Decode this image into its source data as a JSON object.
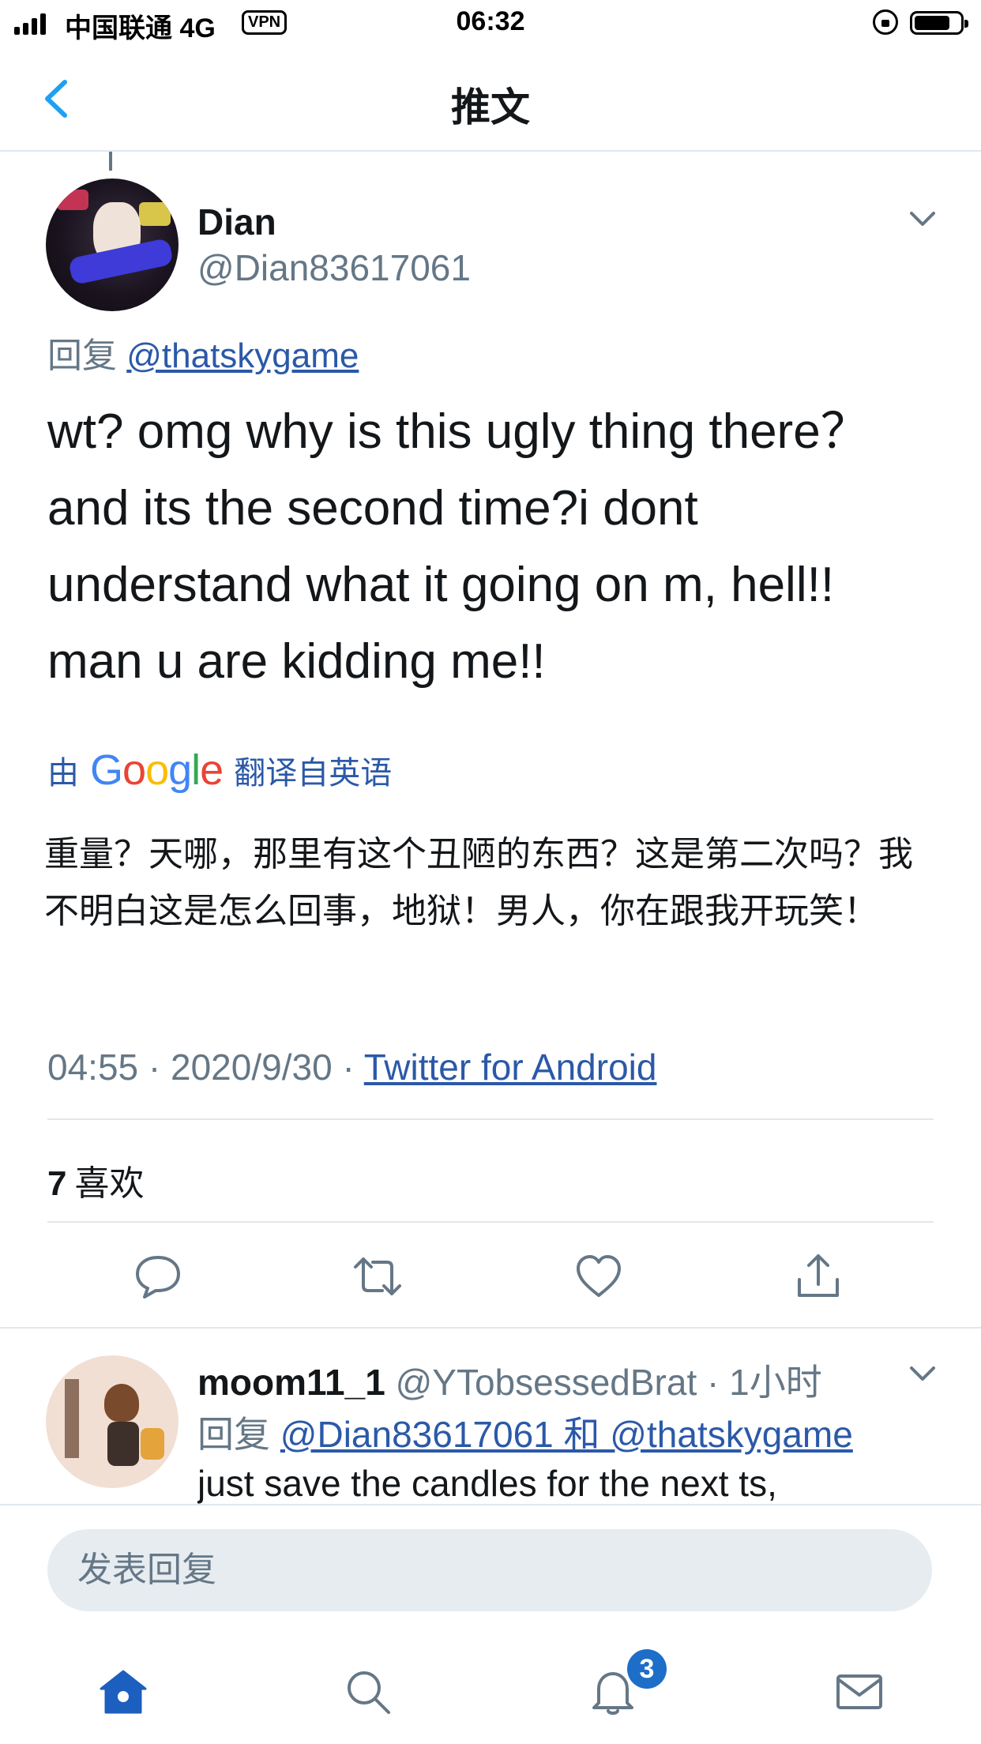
{
  "status_bar": {
    "carrier": "中国联通 4G",
    "vpn": "VPN",
    "time": "06:32"
  },
  "nav": {
    "title": "推文"
  },
  "tweet": {
    "name": "Dian",
    "handle": "@Dian83617061",
    "reply_prefix": "回复",
    "reply_to": "@thatskygame",
    "text": "wt? omg why is this ugly thing there？and its the second time?i dont understand what it going on m, hell!! man u are kidding me!!",
    "translate_prefix": "由",
    "translate_brand": "Google",
    "translate_suffix": "翻译自英语",
    "translated_text": "重量？天哪，那里有这个丑陋的东西？这是第二次吗？我不明白这是怎么回事，地狱！男人，你在跟我开玩笑！",
    "time": "04:55",
    "date": "2020/9/30",
    "separator": "·",
    "source": "Twitter for Android",
    "likes_count": "7",
    "likes_label": "喜欢"
  },
  "reply": {
    "name": "moom11_1",
    "handle": "@YTobsessedBrat",
    "age": "· 1小时",
    "reply_prefix": "回复",
    "reply_to": "@Dian83617061 和 @thatskygame",
    "text": "just save the candles for the next ts,"
  },
  "compose": {
    "placeholder": "发表回复"
  },
  "tabbar": {
    "notifications_badge": "3"
  },
  "colors": {
    "accent": "#1DA1F2",
    "link": "#2B59A8",
    "text_primary": "#14171A",
    "text_secondary": "#657786",
    "divider": "#E1E8ED",
    "compose_bg": "#E6ECF0"
  },
  "icons": [
    "signal-icon",
    "lock-rotation-icon",
    "battery-icon",
    "back-chevron-icon",
    "chevron-down-icon",
    "reply-icon",
    "retweet-icon",
    "like-heart-icon",
    "share-icon",
    "home-icon",
    "search-icon",
    "notifications-bell-icon",
    "messages-envelope-icon"
  ]
}
